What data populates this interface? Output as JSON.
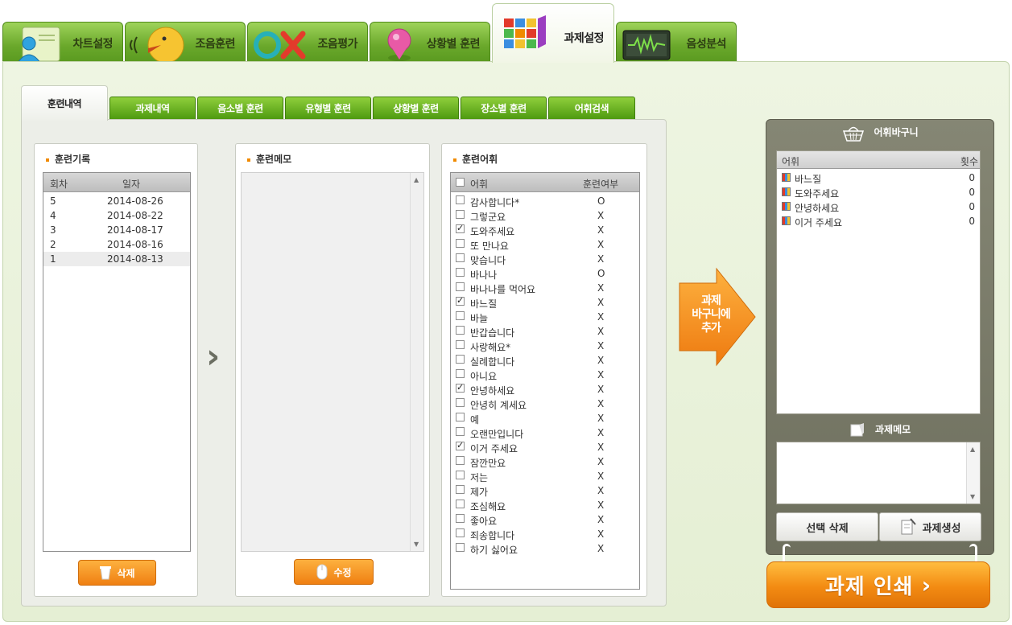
{
  "top_tabs": [
    {
      "label": "차트설정",
      "icon": "person-card-icon"
    },
    {
      "label": "조음훈련",
      "icon": "speaking-face-icon"
    },
    {
      "label": "조음평가",
      "icon": "ox-icon"
    },
    {
      "label": "상황별 훈련",
      "icon": "map-pin-icon"
    },
    {
      "label": "과제설정",
      "icon": "color-cube-icon"
    },
    {
      "label": "음성분석",
      "icon": "waveform-monitor-icon"
    }
  ],
  "sub_tabs": [
    "훈련내역",
    "과제내역",
    "음소별 훈련",
    "유형별 훈련",
    "상황별 훈련",
    "장소별 훈련",
    "어휘검색"
  ],
  "history": {
    "title": "훈련기록",
    "col_round": "회차",
    "col_date": "일자",
    "rows": [
      {
        "round": "5",
        "date": "2014-08-26"
      },
      {
        "round": "4",
        "date": "2014-08-22"
      },
      {
        "round": "3",
        "date": "2014-08-17"
      },
      {
        "round": "2",
        "date": "2014-08-16"
      },
      {
        "round": "1",
        "date": "2014-08-13"
      }
    ],
    "delete_label": "삭제"
  },
  "memo": {
    "title": "훈련메모",
    "edit_label": "수정"
  },
  "vocab": {
    "title": "훈련어휘",
    "col_word": "어휘",
    "col_done": "훈련여부",
    "rows": [
      {
        "word": "감사합니다*",
        "done": "O",
        "checked": false
      },
      {
        "word": "그렇군요",
        "done": "X",
        "checked": false
      },
      {
        "word": "도와주세요",
        "done": "X",
        "checked": true
      },
      {
        "word": "또 만나요",
        "done": "X",
        "checked": false
      },
      {
        "word": "맞습니다",
        "done": "X",
        "checked": false
      },
      {
        "word": "바나나",
        "done": "O",
        "checked": false
      },
      {
        "word": "바나나를 먹어요",
        "done": "X",
        "checked": false
      },
      {
        "word": "바느질",
        "done": "X",
        "checked": true
      },
      {
        "word": "바늘",
        "done": "X",
        "checked": false
      },
      {
        "word": "반갑습니다",
        "done": "X",
        "checked": false
      },
      {
        "word": "사랑해요*",
        "done": "X",
        "checked": false
      },
      {
        "word": "실례합니다",
        "done": "X",
        "checked": false
      },
      {
        "word": "아니요",
        "done": "X",
        "checked": false
      },
      {
        "word": "안녕하세요",
        "done": "X",
        "checked": true
      },
      {
        "word": "안녕히 계세요",
        "done": "X",
        "checked": false
      },
      {
        "word": "예",
        "done": "X",
        "checked": false
      },
      {
        "word": "오랜만입니다",
        "done": "X",
        "checked": false
      },
      {
        "word": "이거 주세요",
        "done": "X",
        "checked": true
      },
      {
        "word": "잠깐만요",
        "done": "X",
        "checked": false
      },
      {
        "word": "저는",
        "done": "X",
        "checked": false
      },
      {
        "word": "제가",
        "done": "X",
        "checked": false
      },
      {
        "word": "조심해요",
        "done": "X",
        "checked": false
      },
      {
        "word": "좋아요",
        "done": "X",
        "checked": false
      },
      {
        "word": "죄송합니다",
        "done": "X",
        "checked": false
      },
      {
        "word": "하기 싫어요",
        "done": "X",
        "checked": false
      }
    ]
  },
  "add_arrow": {
    "line1": "과제",
    "line2": "바구니에",
    "line3": "추가"
  },
  "basket": {
    "title": "어휘바구니",
    "col_word": "어휘",
    "col_count": "횟수",
    "rows": [
      {
        "word": "바느질",
        "count": "0"
      },
      {
        "word": "도와주세요",
        "count": "0"
      },
      {
        "word": "안녕하세요",
        "count": "0"
      },
      {
        "word": "이거 주세요",
        "count": "0"
      }
    ],
    "memo_title": "과제메모",
    "delete_selected_label": "선택 삭제",
    "create_task_label": "과제생성"
  },
  "print_label": "과제 인쇄",
  "colors": {
    "green": "#6aa82b",
    "orange": "#f08a00",
    "basket_bg": "#7a7b69"
  }
}
